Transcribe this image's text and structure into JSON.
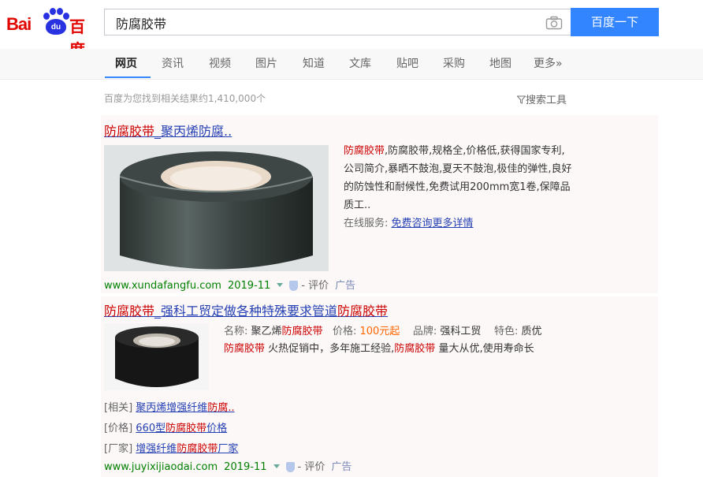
{
  "header": {
    "logo_left": "Bai",
    "logo_mid": "du",
    "logo_right": "百度",
    "search_value": "防腐胶带",
    "search_button": "百度一下"
  },
  "tabs": [
    "网页",
    "资讯",
    "视频",
    "图片",
    "知道",
    "文库",
    "贴吧",
    "采购",
    "地图",
    "更多»"
  ],
  "active_tab": "网页",
  "result_stats": "百度为您找到相关结果约1,410,000个",
  "search_tools": "搜索工具",
  "results": [
    {
      "title_em": "防腐胶带",
      "title_rest": "_聚丙烯防腐..",
      "desc_em": "防腐胶带",
      "desc": ",防腐胶带,规格全,价格低,获得国家专利,公司简介,暴晒不鼓泡,夏天不鼓泡,极佳的弹性,良好的防蚀性和耐候性,免费试用200mm宽1卷,保障品质工..",
      "service_label": "在线服务:",
      "service_link": "免费咨询更多详情",
      "url": "www.xundafangfu.com",
      "date": "2019-11",
      "review": "- 评价",
      "ad": "广告"
    },
    {
      "title_em1": "防腐胶带",
      "title_mid": "_强科工贸定做各种特殊要求管道",
      "title_em2": "防腐胶带",
      "attr_name_label": "名称:",
      "attr_name_pre": "聚乙烯",
      "attr_name_em": "防腐胶带",
      "attr_price_label": "价格:",
      "attr_price": "100元起",
      "attr_brand_label": "品牌:",
      "attr_brand": "强科工贸",
      "attr_feature_label": "特色:",
      "attr_feature": "质优",
      "line2_em1": "防腐胶带",
      "line2_mid": "火热促销中，多年施工经验,",
      "line2_em2": "防腐胶带",
      "line2_rest": "量大从优,使用寿命长",
      "related": [
        {
          "tag": "[相关]",
          "pre": "聚丙烯增强纤维",
          "em": "防腐..",
          "post": ""
        },
        {
          "tag": "[价格]",
          "pre": "660型",
          "em": "防腐胶带",
          "post": "价格"
        },
        {
          "tag": "[厂家]",
          "pre": "增强纤维",
          "em": "防腐胶带",
          "post": "厂家"
        }
      ],
      "url": "www.juyixijiaodai.com",
      "date": "2019-11",
      "review": "- 评价",
      "ad": "广告"
    }
  ],
  "colors": {
    "brand_red": "#e10601",
    "brand_blue": "#2932e1",
    "button_blue": "#3385ff",
    "link_blue": "#2440b3",
    "highlight_red": "#cc0000",
    "url_green": "#008000"
  }
}
